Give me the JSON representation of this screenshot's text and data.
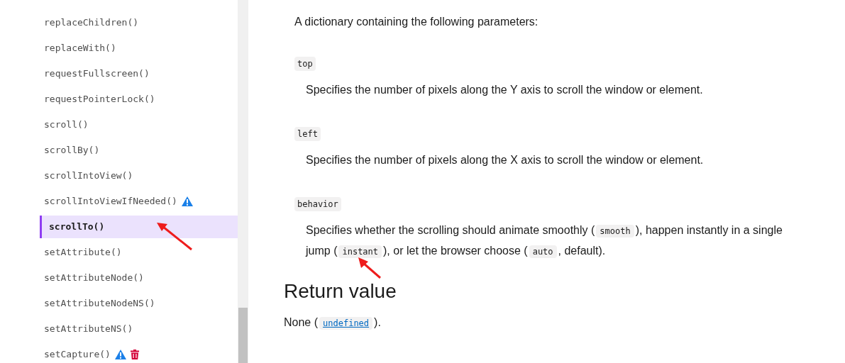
{
  "sidebar": {
    "items": [
      {
        "label": "replaceChildren()",
        "selected": false,
        "non_standard": false,
        "deprecated": false
      },
      {
        "label": "replaceWith()",
        "selected": false,
        "non_standard": false,
        "deprecated": false
      },
      {
        "label": "requestFullscreen()",
        "selected": false,
        "non_standard": false,
        "deprecated": false
      },
      {
        "label": "requestPointerLock()",
        "selected": false,
        "non_standard": false,
        "deprecated": false
      },
      {
        "label": "scroll()",
        "selected": false,
        "non_standard": false,
        "deprecated": false
      },
      {
        "label": "scrollBy()",
        "selected": false,
        "non_standard": false,
        "deprecated": false
      },
      {
        "label": "scrollIntoView()",
        "selected": false,
        "non_standard": false,
        "deprecated": false
      },
      {
        "label": "scrollIntoViewIfNeeded()",
        "selected": false,
        "non_standard": true,
        "deprecated": false
      },
      {
        "label": "scrollTo()",
        "selected": true,
        "non_standard": false,
        "deprecated": false
      },
      {
        "label": "setAttribute()",
        "selected": false,
        "non_standard": false,
        "deprecated": false
      },
      {
        "label": "setAttributeNode()",
        "selected": false,
        "non_standard": false,
        "deprecated": false
      },
      {
        "label": "setAttributeNodeNS()",
        "selected": false,
        "non_standard": false,
        "deprecated": false
      },
      {
        "label": "setAttributeNS()",
        "selected": false,
        "non_standard": false,
        "deprecated": false
      },
      {
        "label": "setCapture()",
        "selected": false,
        "non_standard": true,
        "deprecated": true
      }
    ]
  },
  "content": {
    "intro": "A dictionary containing the following parameters:",
    "parameters": [
      {
        "name": "top",
        "description": [
          {
            "kind": "text",
            "text": "Specifies the number of pixels along the Y axis to scroll the window or element."
          }
        ]
      },
      {
        "name": "left",
        "description": [
          {
            "kind": "text",
            "text": "Specifies the number of pixels along the X axis to scroll the window or element."
          }
        ]
      },
      {
        "name": "behavior",
        "description": [
          {
            "kind": "text",
            "text": "Specifies whether the scrolling should animate smoothly ("
          },
          {
            "kind": "code",
            "text": "smooth"
          },
          {
            "kind": "text",
            "text": "), happen instantly in a single jump ("
          },
          {
            "kind": "code",
            "text": "instant"
          },
          {
            "kind": "text",
            "text": "), or let the browser choose ("
          },
          {
            "kind": "code",
            "text": "auto"
          },
          {
            "kind": "text",
            "text": ", default)."
          }
        ]
      }
    ],
    "return_heading": "Return value",
    "return_text": [
      {
        "kind": "text",
        "text": "None ("
      },
      {
        "kind": "link",
        "text": "undefined"
      },
      {
        "kind": "text",
        "text": ")."
      }
    ]
  }
}
